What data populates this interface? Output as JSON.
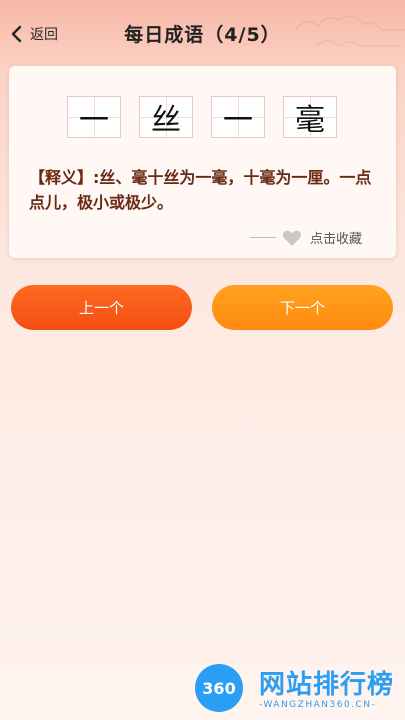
{
  "header": {
    "back_label": "返回",
    "title": "每日成语（4/5）"
  },
  "card": {
    "characters": [
      "一",
      "丝",
      "一",
      "毫"
    ],
    "meaning": "【释义】:丝、毫十丝为一毫，十毫为一厘。一点点儿，极小或极少。",
    "favorite_label": "点击收藏"
  },
  "buttons": {
    "prev_label": "上一个",
    "next_label": "下一个"
  },
  "watermark": {
    "logo_text": "360",
    "name": "网站排行榜",
    "domain": "-WANGZHAN360.CN-"
  },
  "colors": {
    "prev_button": "#f45514",
    "next_button": "#ff9516",
    "meaning_text": "#6b2a14"
  },
  "icons": {
    "back": "chevron-left-icon",
    "favorite": "heart-icon"
  }
}
